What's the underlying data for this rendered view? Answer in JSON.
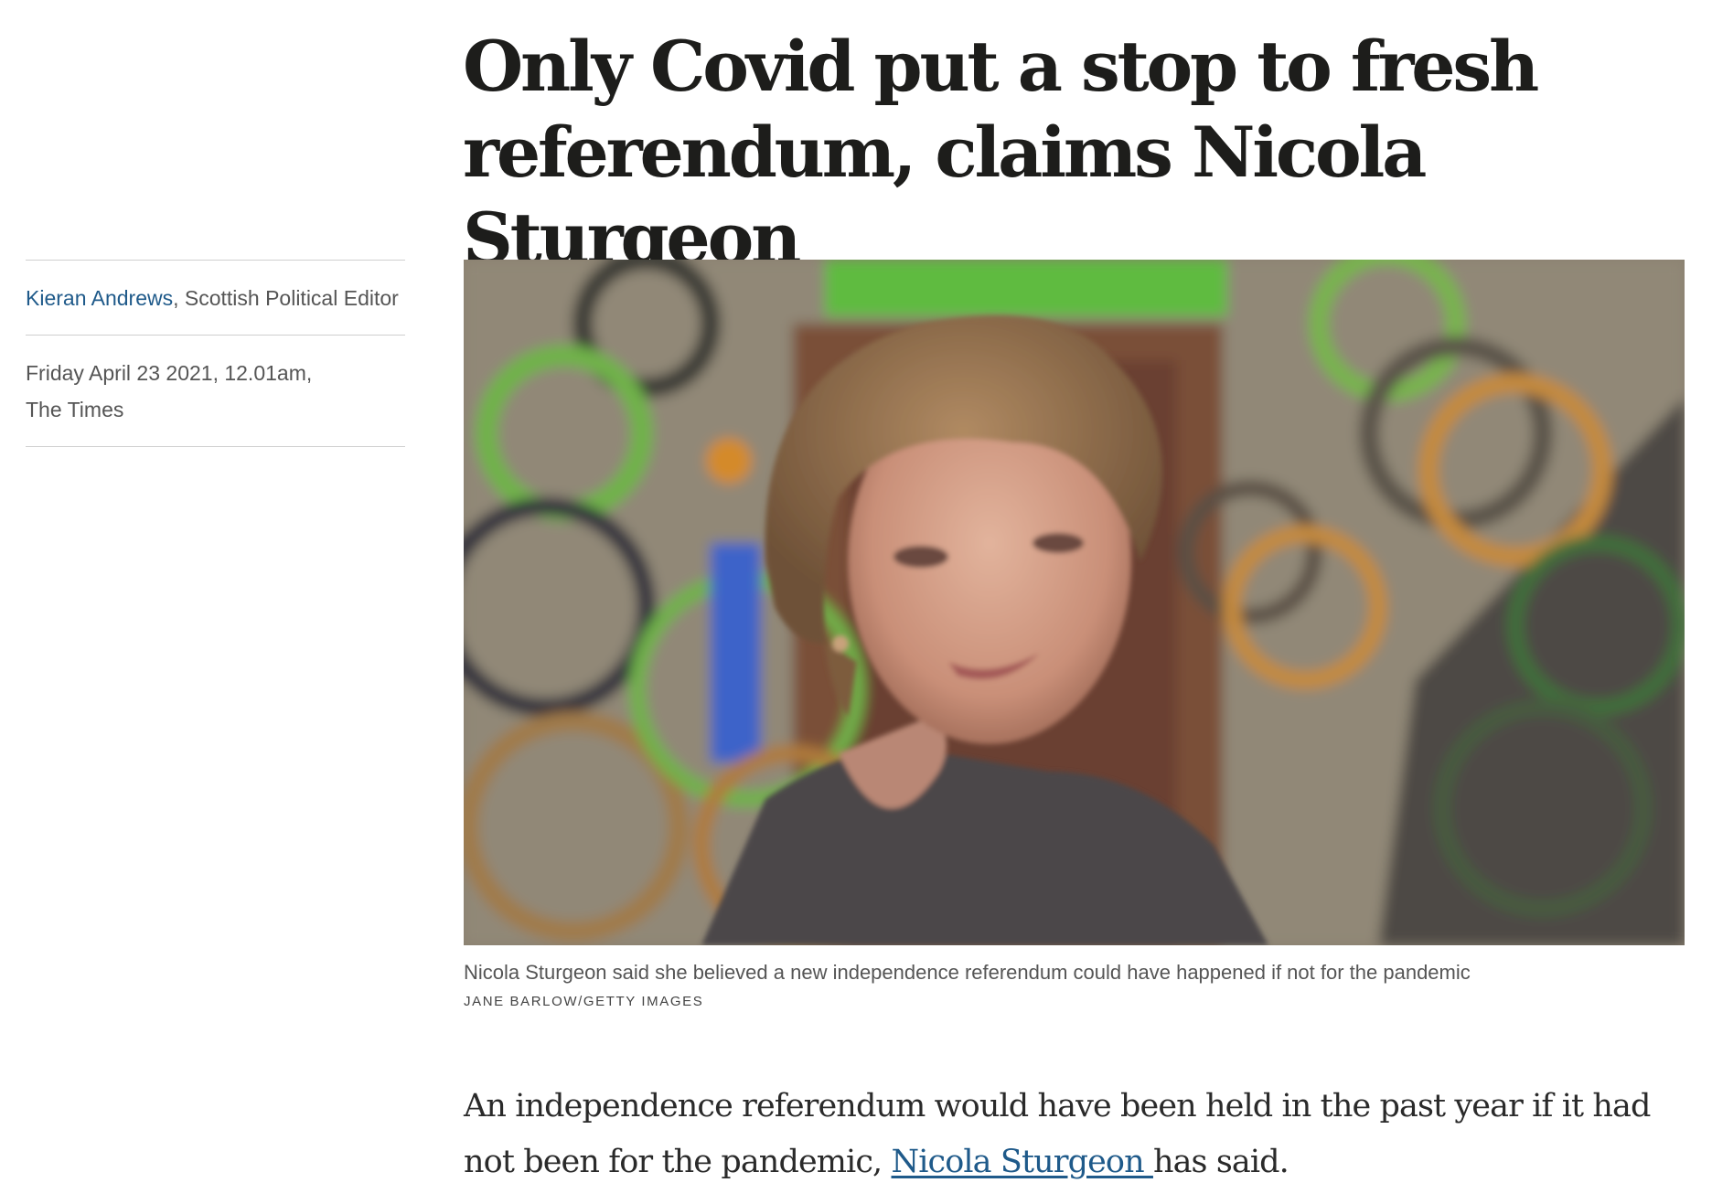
{
  "article": {
    "headline": "Only Covid put a stop to fresh referendum, claims Nicola Sturgeon",
    "author": {
      "name": "Kieran Andrews",
      "separator": ", ",
      "role": "Scottish Political Editor"
    },
    "dateline": {
      "date": "Friday April 23 2021, 12.01am,",
      "publication": "The Times"
    },
    "image": {
      "caption": "Nicola Sturgeon said she believed a new independence referendum could have happened if not for the pandemic",
      "credit": "JANE BARLOW/GETTY IMAGES"
    },
    "body": {
      "intro_before": "An independence referendum would have been held in the past year if it had not been for the pandemic, ",
      "intro_link": "Nicola Sturgeon ",
      "intro_after": "has said."
    }
  }
}
